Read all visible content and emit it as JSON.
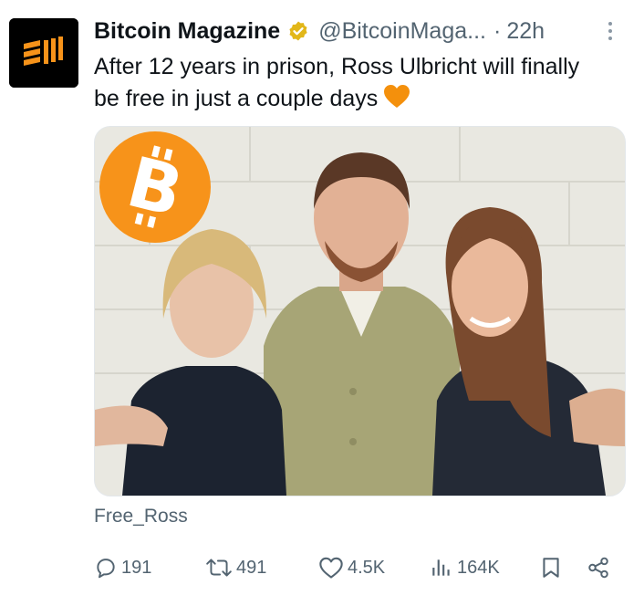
{
  "account": {
    "name": "Bitcoin Magazine",
    "handle": "@BitcoinMaga...",
    "separator": "·",
    "time": "22h",
    "verified_color": "#e2b719"
  },
  "tweet": {
    "text": "After 12 years in prison, Ross Ulbricht will finally be free in just a couple days",
    "emoji": "orange-heart-icon"
  },
  "media": {
    "badge_color": "#f7931a",
    "badge_icon": "bitcoin-logo-icon"
  },
  "caption": "Free_Ross",
  "actions": {
    "replies": "191",
    "reposts": "491",
    "likes": "4.5K",
    "views": "164K"
  },
  "colors": {
    "text": "#0f1419",
    "secondary": "#536471",
    "accent": "#f7931a"
  }
}
